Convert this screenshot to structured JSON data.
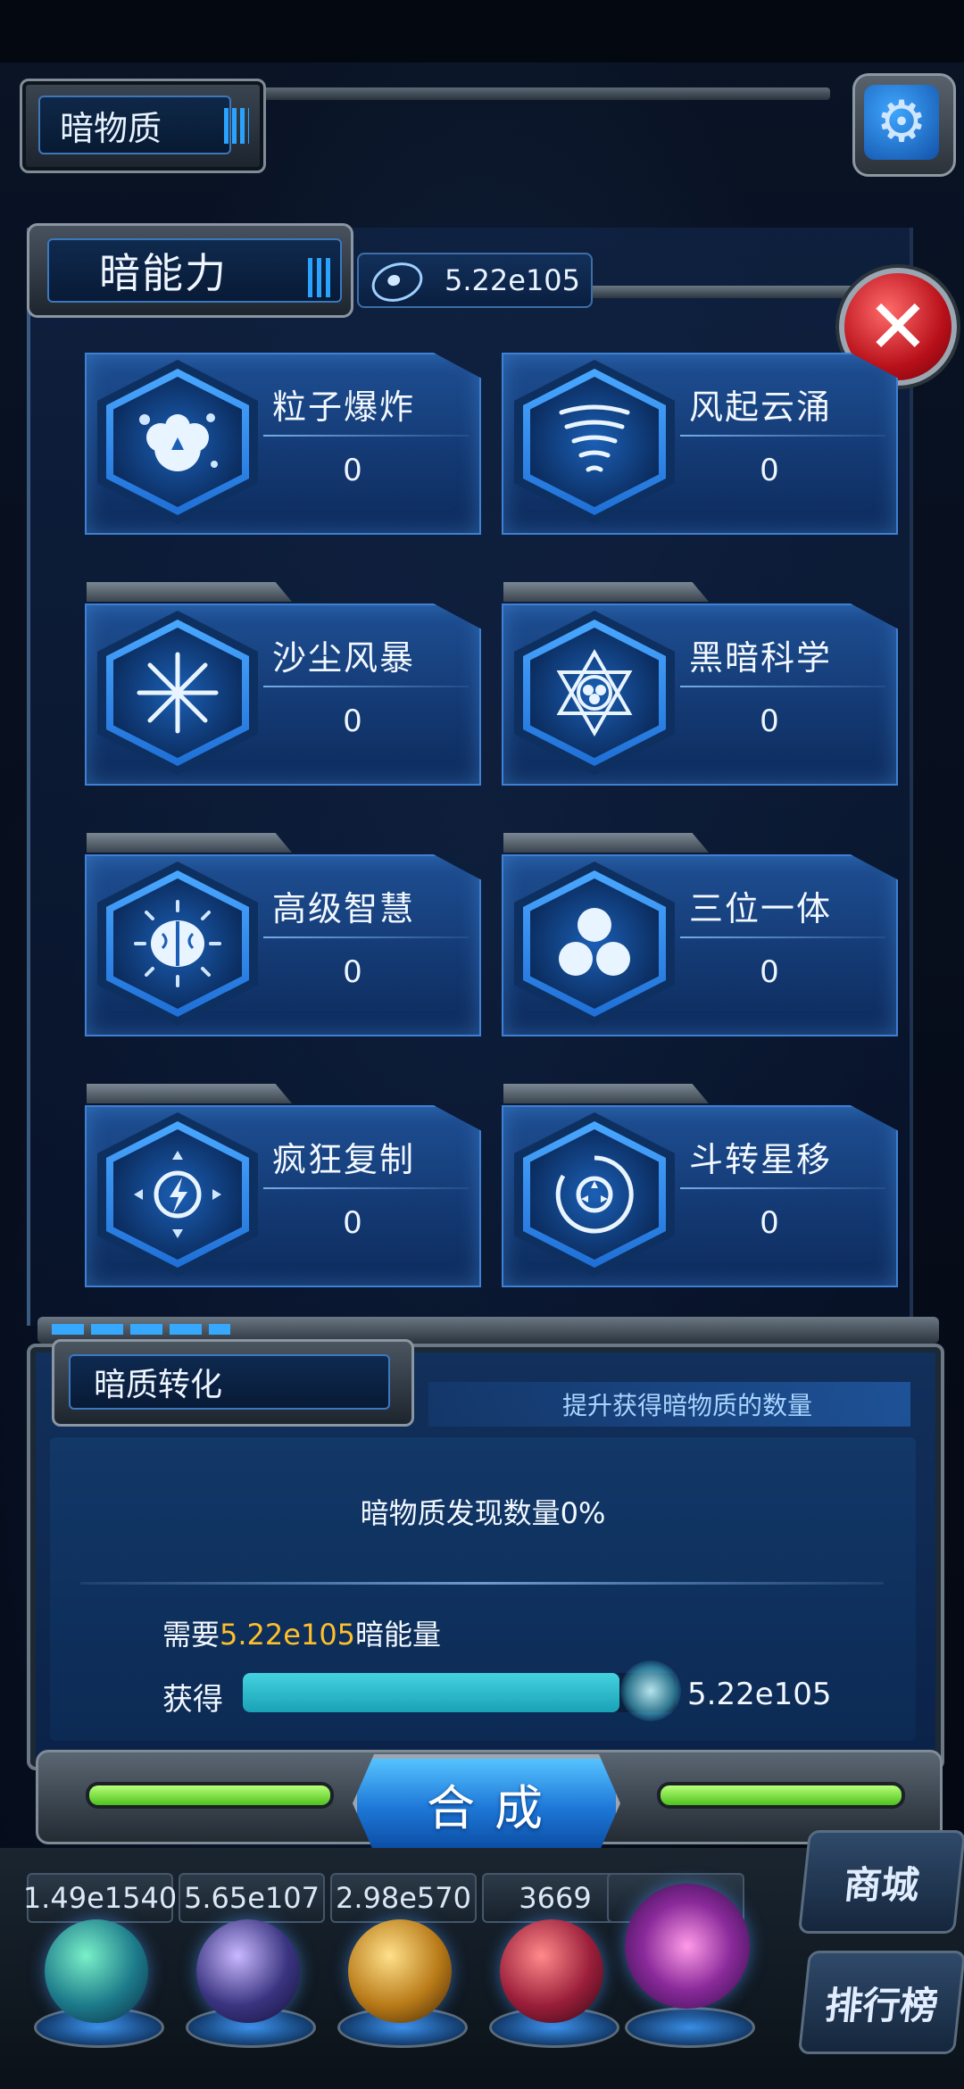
{
  "header": {
    "title": "暗物质"
  },
  "panel": {
    "title": "暗能力",
    "energy_value": "5.22e105"
  },
  "skills": [
    {
      "name": "粒子爆炸",
      "level": "0",
      "icon": "particle-explosion-icon"
    },
    {
      "name": "风起云涌",
      "level": "0",
      "icon": "tornado-icon"
    },
    {
      "name": "沙尘风暴",
      "level": "0",
      "icon": "sandstorm-icon"
    },
    {
      "name": "黑暗科学",
      "level": "0",
      "icon": "dark-science-icon"
    },
    {
      "name": "高级智慧",
      "level": "0",
      "icon": "brain-icon"
    },
    {
      "name": "三位一体",
      "level": "0",
      "icon": "trinity-icon"
    },
    {
      "name": "疯狂复制",
      "level": "0",
      "icon": "lightning-replicate-icon"
    },
    {
      "name": "斗转星移",
      "level": "0",
      "icon": "star-shift-icon"
    }
  ],
  "conversion": {
    "title": "暗质转化",
    "subtitle": "提升获得暗物质的数量",
    "description": "暗物质发现数量0%",
    "need_prefix": "需要",
    "need_amount": "5.22e105",
    "need_suffix": "暗能量",
    "gain_label": "获得",
    "gain_value": "5.22e105",
    "progress_fraction": 0.87
  },
  "synthesize_label": "合成",
  "resources": [
    {
      "value": "1.49e1540"
    },
    {
      "value": "5.65e107"
    },
    {
      "value": "2.98e570"
    },
    {
      "value": "3669"
    }
  ],
  "side_buttons": {
    "shop": "商城",
    "ranking": "排行榜"
  },
  "colors": {
    "accent": "#3d80d4",
    "highlight": "#ffbf2a",
    "progress": "#44d2e0",
    "close": "#c8141e",
    "synthesize": "#1e78d8"
  }
}
